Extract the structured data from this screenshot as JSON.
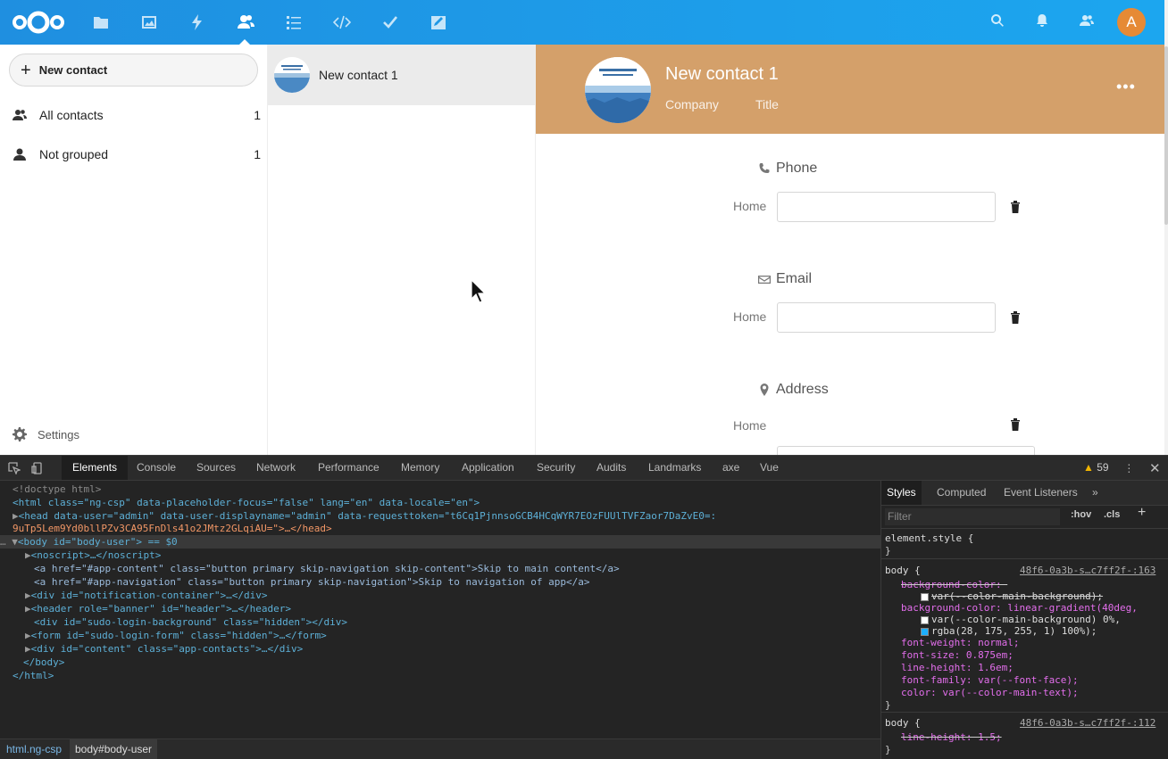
{
  "topbar": {
    "apps": [
      "files-icon",
      "photos-icon",
      "activity-icon",
      "contacts-icon",
      "tasks-icon",
      "code-icon",
      "deck-icon",
      "notes-icon"
    ],
    "avatar_letter": "A"
  },
  "sidebar": {
    "new_contact_label": "New contact",
    "items": [
      {
        "label": "All contacts",
        "count": "1"
      },
      {
        "label": "Not grouped",
        "count": "1"
      }
    ],
    "settings_label": "Settings"
  },
  "contacts": {
    "items": [
      {
        "name": "New contact 1"
      }
    ]
  },
  "details": {
    "name": "New contact 1",
    "company_placeholder": "Company",
    "title_placeholder": "Title",
    "header_color": "#d4a06a",
    "sections": [
      {
        "heading": "Phone",
        "label": "Home"
      },
      {
        "heading": "Email",
        "label": "Home"
      },
      {
        "heading": "Address",
        "label": "Home"
      }
    ]
  },
  "devtools": {
    "tabs": [
      "Elements",
      "Console",
      "Sources",
      "Network",
      "Performance",
      "Memory",
      "Application",
      "Security",
      "Audits",
      "Landmarks",
      "axe",
      "Vue"
    ],
    "warning_count": "59",
    "dom_lines": [
      "<!doctype html>",
      "<html class=\"ng-csp\" data-placeholder-focus=\"false\" lang=\"en\" data-locale=\"en\">",
      "<head data-user=\"admin\" data-user-displayname=\"admin\" data-requesttoken=\"t6Cq1PjnnsoGCB4HCqWYR7EOzFUUlTVFZaor7DaZvE0=:",
      "9uTp5Lem9Yd0bllPZv3CA95FnDls41o2JMtz2GLqiAU=\">…</head>",
      "<body id=\"body-user\"> == $0",
      "<noscript>…</noscript>",
      "<a href=\"#app-content\" class=\"button primary skip-navigation skip-content\">Skip to main content</a>",
      "<a href=\"#app-navigation\" class=\"button primary skip-navigation\">Skip to navigation of app</a>",
      "<div id=\"notification-container\">…</div>",
      "<header role=\"banner\" id=\"header\">…</header>",
      "<div id=\"sudo-login-background\" class=\"hidden\"></div>",
      "<form id=\"sudo-login-form\" class=\"hidden\">…</form>",
      "<div id=\"content\" class=\"app-contacts\">…</div>",
      "</body>",
      "</html>"
    ],
    "breadcrumb": [
      "html.ng-csp",
      "body#body-user"
    ],
    "styles_tabs": [
      "Styles",
      "Computed",
      "Event Listeners"
    ],
    "filter_placeholder": "Filter",
    "hov": ":hov",
    "cls": ".cls",
    "styles": {
      "element_style": "element.style {",
      "rule1_selector": "body {",
      "rule1_source": "48f6-0a3b-s…c7ff2f-:163",
      "rule1_props": [
        "background-color: ",
        "var(--color-main-background);",
        "background-color: linear-gradient(40deg,",
        "var(--color-main-background) 0%,",
        "rgba(28, 175, 255, 1) 100%);",
        "font-weight: normal;",
        "font-size: 0.875em;",
        "line-height: 1.6em;",
        "font-family: var(--font-face);",
        "color: var(--color-main-text);"
      ],
      "rule2_selector": "body {",
      "rule2_source": "48f6-0a3b-s…c7ff2f-:112",
      "rule2_props": [
        "line-height: 1.5;"
      ]
    }
  }
}
